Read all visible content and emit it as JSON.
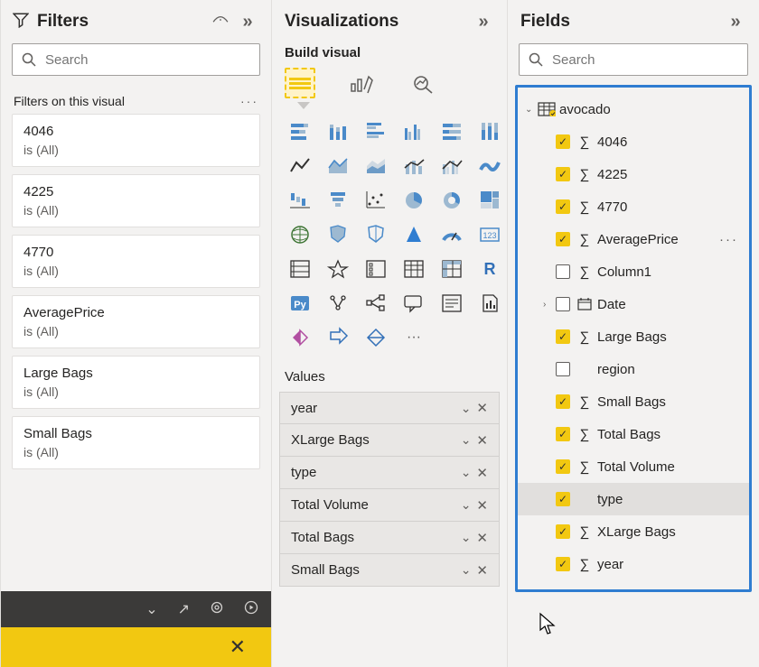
{
  "filters": {
    "title": "Filters",
    "search_placeholder": "Search",
    "section_title": "Filters on this visual",
    "cards": [
      {
        "name": "4046",
        "status": "is (All)"
      },
      {
        "name": "4225",
        "status": "is (All)"
      },
      {
        "name": "4770",
        "status": "is (All)"
      },
      {
        "name": "AveragePrice",
        "status": "is (All)"
      },
      {
        "name": "Large Bags",
        "status": "is (All)"
      },
      {
        "name": "Small Bags",
        "status": "is (All)"
      }
    ]
  },
  "viz": {
    "title": "Visualizations",
    "subtitle": "Build visual",
    "values_title": "Values",
    "values": [
      {
        "name": "year"
      },
      {
        "name": "XLarge Bags"
      },
      {
        "name": "type"
      },
      {
        "name": "Total Volume"
      },
      {
        "name": "Total Bags"
      },
      {
        "name": "Small Bags"
      }
    ],
    "chart_types": [
      "stacked-bar",
      "stacked-column",
      "clustered-bar",
      "clustered-column",
      "100-stacked-bar",
      "100-stacked-column",
      "line",
      "area",
      "stacked-area",
      "line-stacked-column",
      "line-clustered-column",
      "ribbon",
      "waterfall",
      "funnel",
      "scatter",
      "pie",
      "donut",
      "treemap",
      "map",
      "filled-map",
      "shape-map",
      "azure-map",
      "gauge",
      "card",
      "multi-row-card",
      "kpi",
      "slicer",
      "table",
      "matrix",
      "r-visual",
      "python-visual",
      "key-influencers",
      "decomposition-tree",
      "qna",
      "smart-narrative",
      "paginated-report",
      "power-apps",
      "power-automate",
      "get-more-visuals",
      "more"
    ]
  },
  "fields": {
    "title": "Fields",
    "search_placeholder": "Search",
    "table": {
      "name": "avocado"
    },
    "items": [
      {
        "name": "4046",
        "checked": true,
        "sigma": true,
        "expandable": false,
        "more": false,
        "highlight": false
      },
      {
        "name": "4225",
        "checked": true,
        "sigma": true,
        "expandable": false,
        "more": false,
        "highlight": false
      },
      {
        "name": "4770",
        "checked": true,
        "sigma": true,
        "expandable": false,
        "more": false,
        "highlight": false
      },
      {
        "name": "AveragePrice",
        "checked": true,
        "sigma": true,
        "expandable": false,
        "more": true,
        "highlight": false
      },
      {
        "name": "Column1",
        "checked": false,
        "sigma": true,
        "expandable": false,
        "more": false,
        "highlight": false
      },
      {
        "name": "Date",
        "checked": false,
        "sigma": false,
        "date": true,
        "expandable": true,
        "more": false,
        "highlight": false
      },
      {
        "name": "Large Bags",
        "checked": true,
        "sigma": true,
        "expandable": false,
        "more": false,
        "highlight": false
      },
      {
        "name": "region",
        "checked": false,
        "sigma": false,
        "expandable": false,
        "more": false,
        "highlight": false
      },
      {
        "name": "Small Bags",
        "checked": true,
        "sigma": true,
        "expandable": false,
        "more": false,
        "highlight": false
      },
      {
        "name": "Total Bags",
        "checked": true,
        "sigma": true,
        "expandable": false,
        "more": false,
        "highlight": false
      },
      {
        "name": "Total Volume",
        "checked": true,
        "sigma": true,
        "expandable": false,
        "more": false,
        "highlight": false
      },
      {
        "name": "type",
        "checked": true,
        "sigma": false,
        "expandable": false,
        "more": false,
        "highlight": true
      },
      {
        "name": "XLarge Bags",
        "checked": true,
        "sigma": true,
        "expandable": false,
        "more": false,
        "highlight": false
      },
      {
        "name": "year",
        "checked": true,
        "sigma": true,
        "expandable": false,
        "more": false,
        "highlight": false
      }
    ]
  }
}
